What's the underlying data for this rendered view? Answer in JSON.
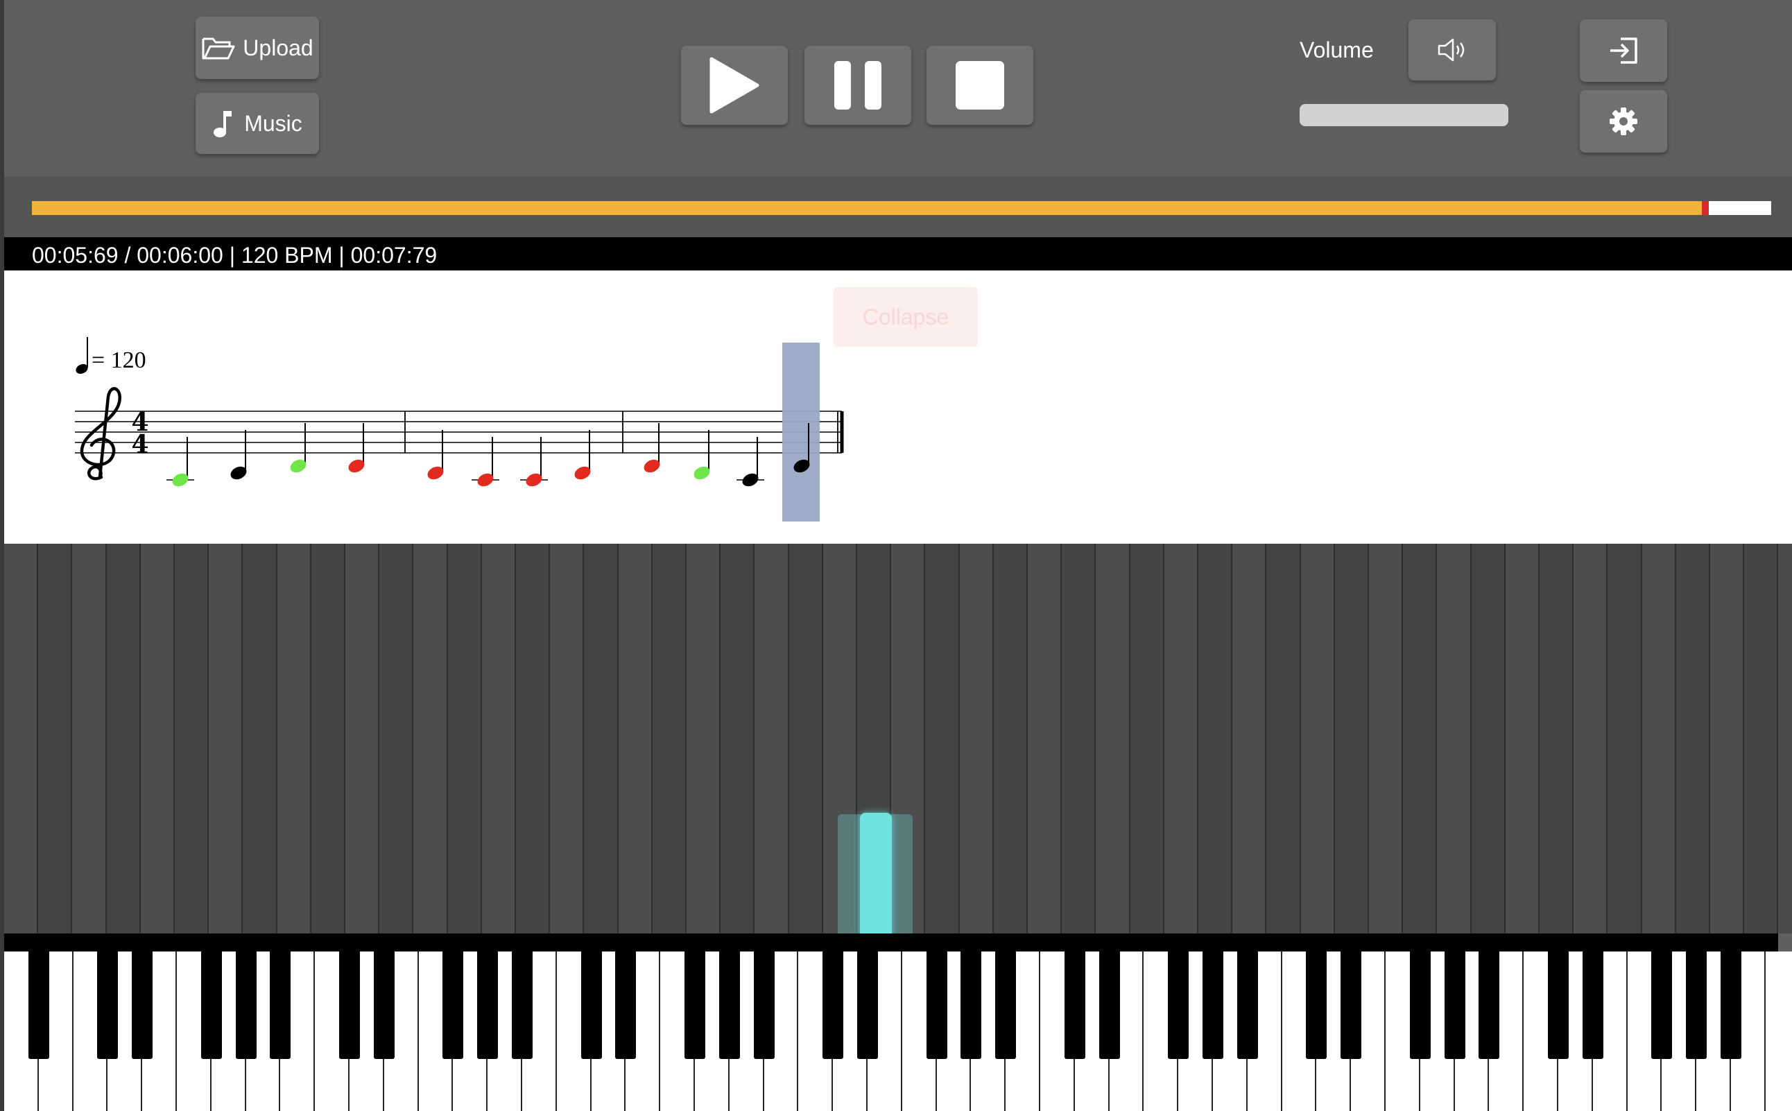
{
  "toolbar": {
    "upload_label": "Upload",
    "music_label": "Music",
    "volume_label": "Volume",
    "icons": {
      "upload": "folder-open-icon",
      "music": "music-note-icon",
      "play": "play-icon",
      "pause": "pause-icon",
      "stop": "stop-icon",
      "volume": "speaker-icon",
      "exit": "sign-in-icon",
      "settings": "gear-icon"
    }
  },
  "progress": {
    "fraction": 0.96,
    "fill_color": "#f2b33d",
    "marker_color": "#d62c2c"
  },
  "status": {
    "text": "00:05:69 / 00:06:00 | 120 BPM | 00:07:79"
  },
  "score": {
    "tempo_text": "= 120",
    "time_signature": [
      "4",
      "4"
    ],
    "collapse_label": "Collapse",
    "note_colors": {
      "correct": "#6ee64a",
      "wrong": "#e32a1f",
      "pending": "#000000"
    },
    "measures": [
      [
        "correct",
        "pending",
        "correct",
        "wrong"
      ],
      [
        "wrong",
        "wrong",
        "wrong",
        "wrong"
      ],
      [
        "wrong",
        "correct",
        "pending",
        "pending"
      ]
    ]
  },
  "falling_note_color": "#6fe3df"
}
